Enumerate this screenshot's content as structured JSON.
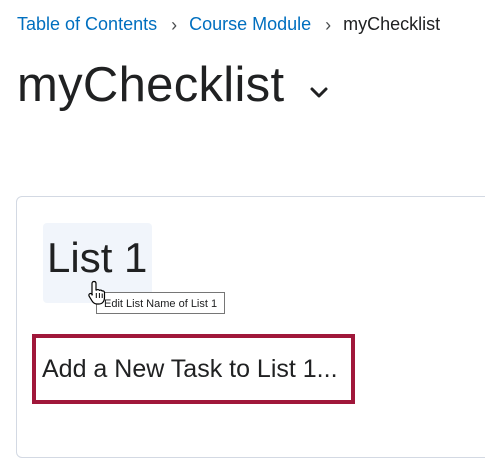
{
  "breadcrumb": {
    "items": [
      {
        "label": "Table of Contents"
      },
      {
        "label": "Course Module"
      }
    ],
    "separator": "›",
    "current": "myChecklist"
  },
  "page": {
    "title": "myChecklist",
    "title_menu_icon": "chevron-down-icon"
  },
  "list": {
    "name": "List 1",
    "edit_tooltip": "Edit List Name of List 1",
    "add_task_label": "Add a New Task to List 1...",
    "highlight_color": "#a0173a"
  },
  "colors": {
    "link": "#006fbf",
    "text": "#202122",
    "card_border": "#d3d9e3",
    "hover_bg": "#f1f5fb"
  },
  "cursor": {
    "type": "hand-pointer-icon"
  }
}
